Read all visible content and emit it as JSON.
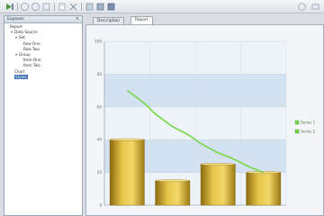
{
  "toolbar": {
    "icons": [
      "run-icon",
      "back-icon",
      "forward-icon",
      "refresh-icon",
      "edit-icon",
      "cut-icon",
      "settings-icon",
      "view-icon",
      "grid-icon",
      "help-icon",
      "tools-icon"
    ]
  },
  "left_panel": {
    "title": "Explorer",
    "close_glyph": "×",
    "tree": [
      {
        "label": "Report",
        "level": 0,
        "toggle": ""
      },
      {
        "label": "Data Source",
        "level": 1,
        "toggle": "▾"
      },
      {
        "label": "Set",
        "level": 2,
        "toggle": "▾"
      },
      {
        "label": "Row One",
        "level": 3,
        "toggle": ""
      },
      {
        "label": "Row Two",
        "level": 3,
        "toggle": ""
      },
      {
        "label": "Group",
        "level": 2,
        "toggle": "▾"
      },
      {
        "label": "Item One",
        "level": 3,
        "toggle": ""
      },
      {
        "label": "Item Two",
        "level": 3,
        "toggle": ""
      },
      {
        "label": "Chart",
        "level": 1,
        "toggle": ""
      },
      {
        "label": "Styles",
        "level": 1,
        "toggle": "",
        "selected": true
      }
    ]
  },
  "tabs": [
    {
      "label": "Description",
      "active": false
    },
    {
      "label": "Report",
      "active": true
    }
  ],
  "chart_data": {
    "type": "bar",
    "categories": [
      "",
      "",
      "",
      ""
    ],
    "series": [
      {
        "name": "",
        "type": "bar",
        "values": [
          40,
          15,
          25,
          20
        ]
      },
      {
        "name": "",
        "type": "line",
        "values": [
          70,
          48,
          32,
          20
        ]
      }
    ],
    "ylim": [
      0,
      100
    ],
    "yticks": [
      "0",
      "20",
      "40",
      "60",
      "80",
      "100"
    ],
    "legend": {
      "placement": "right",
      "entries": [
        "Series 1",
        "Series 2"
      ]
    },
    "grid": true,
    "colors": {
      "bar": "#c9a227",
      "line": "#76d64a",
      "band": "#d3e1f1"
    }
  }
}
